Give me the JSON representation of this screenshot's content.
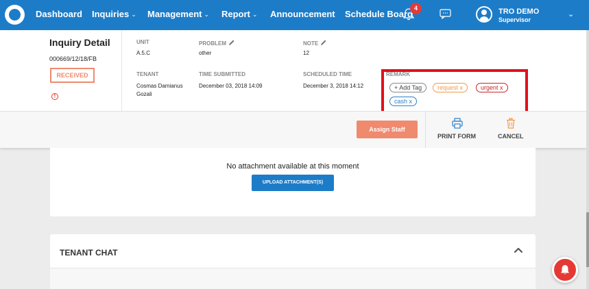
{
  "nav": {
    "items": [
      {
        "label": "Dashboard",
        "has_caret": false
      },
      {
        "label": "Inquiries",
        "has_caret": true
      },
      {
        "label": "Management",
        "has_caret": true
      },
      {
        "label": "Report",
        "has_caret": true
      },
      {
        "label": "Announcement",
        "has_caret": false
      },
      {
        "label": "Schedule Board",
        "has_caret": false
      }
    ],
    "notification_count": "4",
    "user": {
      "name": "TRO DEMO",
      "role": "Supervisor"
    },
    "brand_color": "#1d7cc8"
  },
  "inquiry": {
    "title": "Inquiry Detail",
    "reference": "000669/12/18/FB",
    "status": "RECEIVED",
    "unit_label": "UNIT",
    "unit": "A.5.C",
    "problem_label": "PROBLEM",
    "problem": "other",
    "note_label": "NOTE",
    "note": "12",
    "tenant_label": "TENANT",
    "tenant": "Cosmas Damianus Gozali",
    "time_submitted_label": "TIME SUBMITTED",
    "time_submitted": "December 03, 2018 14:09",
    "scheduled_time_label": "SCHEDULED TIME",
    "scheduled_time": "December 3, 2018 14:12",
    "remark_label": "REMARK",
    "tags": {
      "add": "+ Add Tag",
      "request": "request x",
      "urgent": "urgent x",
      "cash": "cash x"
    }
  },
  "actions": {
    "assign_staff": "Assign Staff",
    "print_form": "PRINT FORM",
    "cancel": "CANCEL"
  },
  "attachments": {
    "empty_text": "No attachment available at this moment",
    "upload_button": "UPLOAD ATTACHMENT(S)"
  },
  "tenant_chat": {
    "title": "TENANT CHAT"
  },
  "colors": {
    "status_accent": "#ef8a6e",
    "highlight_box": "#e0101c",
    "tag_request": "#ef9a4a",
    "tag_urgent": "#c62828",
    "tag_cash": "#2b7fc8"
  }
}
